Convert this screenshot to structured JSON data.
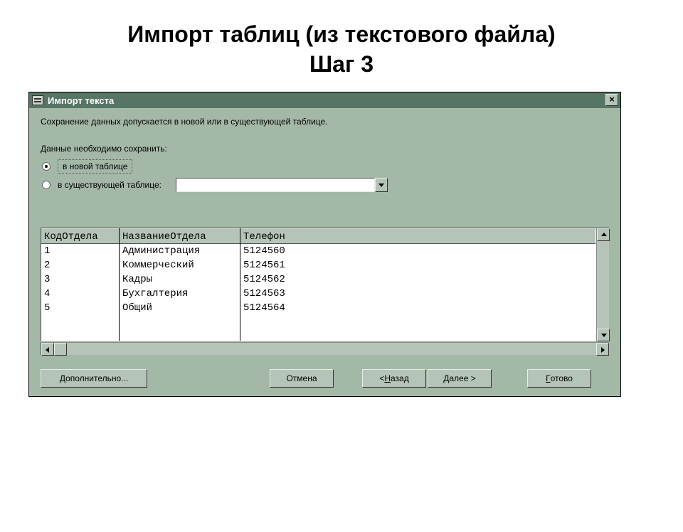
{
  "slide": {
    "title_line1": "Импорт таблиц (из текстового файла)",
    "title_line2": "Шаг 3"
  },
  "window": {
    "title": "Импорт текста",
    "close": "×",
    "instruction": "Сохранение данных допускается в новой или в существующей таблице.",
    "subhead": "Данные необходимо сохранить:",
    "radio_new": "в новой таблице",
    "radio_existing": "в существующей таблице:"
  },
  "preview": {
    "headers": [
      "КодОтдела",
      "НазваниеОтдела",
      "Телефон"
    ],
    "rows": [
      [
        "1",
        "Администрация",
        "5124560"
      ],
      [
        "2",
        "Коммерческий",
        "5124561"
      ],
      [
        "3",
        "Кадры",
        "5124562"
      ],
      [
        "4",
        "Бухгалтерия",
        "5124563"
      ],
      [
        "5",
        "Общий",
        "5124564"
      ]
    ]
  },
  "buttons": {
    "advanced": "Дополнительно...",
    "cancel": "Отмена",
    "back_pre": "< ",
    "back_u": "Н",
    "back_post": "азад",
    "next_pre": "",
    "next_u": "Д",
    "next_post": "алее >",
    "finish_pre": "",
    "finish_u": "Г",
    "finish_post": "отово"
  }
}
